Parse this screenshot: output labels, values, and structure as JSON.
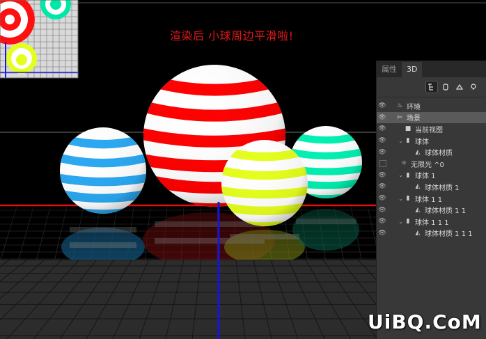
{
  "caption": "渲染后 小球周边平滑啦!",
  "panel": {
    "tabs": [
      {
        "label": "属性",
        "active": false
      },
      {
        "label": "3D",
        "active": true
      }
    ],
    "toolbar": [
      {
        "icon": "scene-filter-icon",
        "active": true
      },
      {
        "icon": "mesh-filter-icon",
        "active": false
      },
      {
        "icon": "material-filter-icon",
        "active": false
      },
      {
        "icon": "light-filter-icon",
        "active": false
      }
    ],
    "layers": [
      {
        "label": "环境",
        "icon": "environment-icon",
        "visible": true,
        "level": 0,
        "expandable": false
      },
      {
        "label": "场景",
        "icon": "scene-icon",
        "visible": true,
        "level": 0,
        "expandable": false,
        "selected": true
      },
      {
        "label": "当前视图",
        "icon": "camera-icon",
        "visible": true,
        "level": 1,
        "expandable": false
      },
      {
        "label": "球体",
        "icon": "mesh-icon",
        "visible": true,
        "level": 1,
        "expandable": true
      },
      {
        "label": "球体材质",
        "icon": "material-icon",
        "visible": true,
        "level": 2,
        "expandable": false
      },
      {
        "label": "无限光 ^0",
        "icon": "light-icon",
        "visible": false,
        "level": 1,
        "expandable": false
      },
      {
        "label": "球体 1",
        "icon": "mesh-icon",
        "visible": true,
        "level": 1,
        "expandable": true
      },
      {
        "label": "球体材质 1",
        "icon": "material-icon",
        "visible": true,
        "level": 2,
        "expandable": false
      },
      {
        "label": "球体 1 1",
        "icon": "mesh-icon",
        "visible": true,
        "level": 1,
        "expandable": true
      },
      {
        "label": "球体材质 1 1",
        "icon": "material-icon",
        "visible": true,
        "level": 2,
        "expandable": false
      },
      {
        "label": "球体 1 1 1",
        "icon": "mesh-icon",
        "visible": true,
        "level": 1,
        "expandable": true
      },
      {
        "label": "球体材质 1 1 1",
        "icon": "material-icon",
        "visible": true,
        "level": 2,
        "expandable": false
      }
    ]
  },
  "colors": {
    "red": "#ff0000",
    "blue": "#2aa8f2",
    "yellow": "#e4ff1c",
    "green": "#00f0b0",
    "caption": "#e0181a"
  },
  "watermark": "UiBQ.CoM"
}
